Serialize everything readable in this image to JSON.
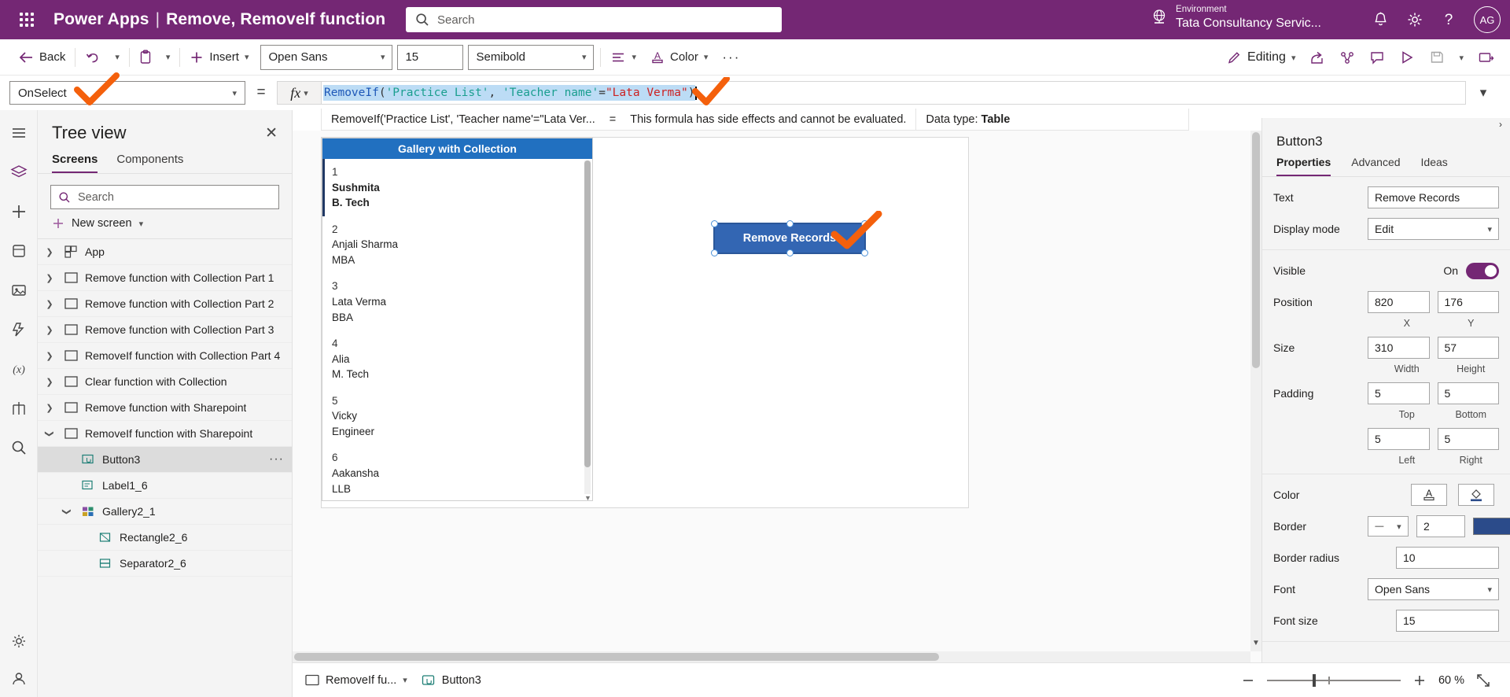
{
  "topbar": {
    "waffle_icon": "app-launcher-icon",
    "brand": "Power Apps",
    "separator": "|",
    "subtitle": "Remove, RemoveIf function",
    "search_placeholder": "Search",
    "search_icon": "search-icon",
    "environment_label": "Environment",
    "environment_name": "Tata Consultancy Servic...",
    "globe_icon": "globe-icon",
    "bell_icon": "bell-notification-icon",
    "gear_icon": "gear-settings-icon",
    "help_icon": "help-question-icon",
    "avatar_initials": "AG",
    "brand_color": "#742774"
  },
  "commandbar": {
    "back_label": "Back",
    "undo_icon": "undo-arrow-icon",
    "paste_icon": "clipboard-paste-icon",
    "insert_label": "Insert",
    "font_family": "Open Sans",
    "font_size": "15",
    "font_weight": "Semibold",
    "align_icon": "text-align-icon",
    "color_label": "Color",
    "more_label": "···",
    "editing_label": "Editing",
    "edit_pencil_icon": "pencil-edit-icon",
    "share_icon": "share-icon",
    "flow_icon": "power-automate-icon",
    "comment_icon": "comment-icon",
    "play_icon": "preview-play-icon",
    "save_icon": "save-icon",
    "publish_icon": "publish-icon"
  },
  "formulabar": {
    "property": "OnSelect",
    "equals": "=",
    "fx_label": "fx",
    "formula_parts": [
      {
        "text": "RemoveIf",
        "kind": "fn"
      },
      {
        "text": "(",
        "kind": "punc"
      },
      {
        "text": "'Practice List'",
        "kind": "str"
      },
      {
        "text": ", ",
        "kind": "punc"
      },
      {
        "text": "'Teacher name'",
        "kind": "str"
      },
      {
        "text": "=",
        "kind": "punc"
      },
      {
        "text": "\"Lata Verma\"",
        "kind": "red"
      },
      {
        "text": ")",
        "kind": "punc"
      }
    ],
    "formula_plain": "RemoveIf('Practice List', 'Teacher name'=\"Lata Verma\")",
    "expand_icon": "chevron-down-icon"
  },
  "formula_result": {
    "expression": "RemoveIf('Practice List', 'Teacher name'=\"Lata Ver...",
    "equals": "=",
    "message": "This formula has side effects and cannot be evaluated.",
    "datatype_label": "Data type:",
    "datatype_value": "Table"
  },
  "rail": {
    "items": [
      {
        "name": "hamburger-menu-icon"
      },
      {
        "name": "data-layers-icon"
      },
      {
        "name": "insert-plus-icon"
      },
      {
        "name": "data-sources-icon"
      },
      {
        "name": "media-icon"
      },
      {
        "name": "power-automate-icon"
      },
      {
        "name": "variables-icon"
      },
      {
        "name": "components-tree-icon"
      },
      {
        "name": "search-icon"
      }
    ],
    "bottom": [
      {
        "name": "settings-gear-icon"
      },
      {
        "name": "account-icon"
      }
    ]
  },
  "treeview": {
    "title": "Tree view",
    "close_icon": "close-icon",
    "tabs": [
      {
        "label": "Screens",
        "selected": true
      },
      {
        "label": "Components",
        "selected": false
      }
    ],
    "search_placeholder": "Search",
    "search_icon": "search-icon",
    "new_screen_label": "New screen",
    "plus_icon": "plus-icon",
    "items": [
      {
        "label": "App",
        "indent": 0,
        "chevron": "right",
        "icon": "app-icon",
        "selected": false
      },
      {
        "label": "Remove function with Collection Part 1",
        "indent": 0,
        "chevron": "right",
        "icon": "screen-icon",
        "selected": false
      },
      {
        "label": "Remove function with Collection Part 2",
        "indent": 0,
        "chevron": "right",
        "icon": "screen-icon",
        "selected": false
      },
      {
        "label": "Remove function with Collection Part 3",
        "indent": 0,
        "chevron": "right",
        "icon": "screen-icon",
        "selected": false
      },
      {
        "label": "RemoveIf function with Collection Part 4",
        "indent": 0,
        "chevron": "right",
        "icon": "screen-icon",
        "selected": false
      },
      {
        "label": "Clear function with Collection",
        "indent": 0,
        "chevron": "right",
        "icon": "screen-icon",
        "selected": false
      },
      {
        "label": "Remove function with Sharepoint",
        "indent": 0,
        "chevron": "right",
        "icon": "screen-icon",
        "selected": false
      },
      {
        "label": "RemoveIf function with Sharepoint",
        "indent": 0,
        "chevron": "down",
        "icon": "screen-icon",
        "selected": false
      },
      {
        "label": "Button3",
        "indent": 1,
        "chevron": "none",
        "icon": "button-icon",
        "selected": true,
        "dots": "···"
      },
      {
        "label": "Label1_6",
        "indent": 1,
        "chevron": "none",
        "icon": "label-icon",
        "selected": false
      },
      {
        "label": "Gallery2_1",
        "indent": 1,
        "chevron": "down",
        "icon": "gallery-icon",
        "selected": false
      },
      {
        "label": "Rectangle2_6",
        "indent": 2,
        "chevron": "none",
        "icon": "rectangle-icon",
        "selected": false
      },
      {
        "label": "Separator2_6",
        "indent": 2,
        "chevron": "none",
        "icon": "separator-icon",
        "selected": false
      }
    ]
  },
  "canvas": {
    "gallery_title": "Gallery with Collection",
    "gallery_items": [
      {
        "num": "1",
        "name": "Sushmita",
        "degree": "B. Tech",
        "selected": true
      },
      {
        "num": "2",
        "name": "Anjali Sharma",
        "degree": "MBA",
        "selected": false
      },
      {
        "num": "3",
        "name": "Lata Verma",
        "degree": "BBA",
        "selected": false
      },
      {
        "num": "4",
        "name": "Alia",
        "degree": "M. Tech",
        "selected": false
      },
      {
        "num": "5",
        "name": "Vicky",
        "degree": "Engineer",
        "selected": false
      },
      {
        "num": "6",
        "name": "Aakansha",
        "degree": "LLB",
        "selected": false
      }
    ],
    "button_label": "Remove Records",
    "button_color": "#3366b3"
  },
  "properties": {
    "element_name": "Button3",
    "tabs": [
      {
        "label": "Properties",
        "selected": true
      },
      {
        "label": "Advanced",
        "selected": false
      },
      {
        "label": "Ideas",
        "selected": false
      }
    ],
    "text_label": "Text",
    "text_value": "Remove Records",
    "displaymode_label": "Display mode",
    "displaymode_value": "Edit",
    "visible_label": "Visible",
    "visible_state": "On",
    "position_label": "Position",
    "position_x": "820",
    "position_y": "176",
    "position_x_caption": "X",
    "position_y_caption": "Y",
    "size_label": "Size",
    "size_width": "310",
    "size_height": "57",
    "size_width_caption": "Width",
    "size_height_caption": "Height",
    "padding_label": "Padding",
    "padding_top": "5",
    "padding_bottom": "5",
    "padding_left": "5",
    "padding_right": "5",
    "padding_top_caption": "Top",
    "padding_bottom_caption": "Bottom",
    "padding_left_caption": "Left",
    "padding_right_caption": "Right",
    "color_label": "Color",
    "color_text_icon": "font-color-A-icon",
    "color_fill_icon": "fill-bucket-icon",
    "border_label": "Border",
    "border_style": "—",
    "border_width": "2",
    "border_color": "#2b4b8a",
    "borderradius_label": "Border radius",
    "borderradius_value": "10",
    "font_label": "Font",
    "font_value": "Open Sans",
    "fontsize_label": "Font size",
    "fontsize_value": "15"
  },
  "bottombar": {
    "screen_name": "RemoveIf fu...",
    "screen_icon": "screen-icon",
    "control_name": "Button3",
    "control_icon": "button-icon",
    "minus_icon": "zoom-out-minus-icon",
    "plus_icon": "zoom-in-plus-icon",
    "zoom_value": "60",
    "zoom_unit": "%",
    "fit_icon": "fit-to-screen-icon"
  },
  "annotation_color": "#f4600c"
}
